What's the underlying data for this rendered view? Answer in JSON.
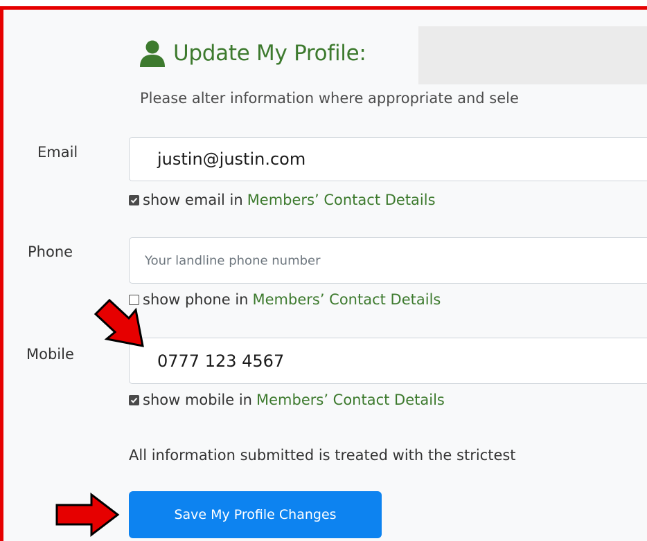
{
  "header": {
    "title": "Update My Profile:",
    "intro": "Please alter information where appropriate and sele"
  },
  "fields": {
    "email": {
      "label": "Email",
      "value": "justin@justin.com",
      "checkbox_checked": true,
      "checkbox_text": "show email in",
      "checkbox_link": "Members’ Contact Details"
    },
    "phone": {
      "label": "Phone",
      "value": "",
      "placeholder": "Your landline phone number",
      "checkbox_checked": false,
      "checkbox_text": "show phone in",
      "checkbox_link": "Members’ Contact Details"
    },
    "mobile": {
      "label": "Mobile",
      "value": "0777 123 4567",
      "checkbox_checked": true,
      "checkbox_text": "show mobile in",
      "checkbox_link": "Members’ Contact Details"
    }
  },
  "privacy_notice": "All information submitted is treated with the strictest",
  "save_button": {
    "label": "Save My Profile Changes"
  },
  "icons": {
    "title": "user-icon",
    "callouts": "red-arrow-icon"
  },
  "colors": {
    "accent_green": "#3d7a2e",
    "button_blue": "#0d83f0",
    "annotation_red": "#e60000"
  }
}
